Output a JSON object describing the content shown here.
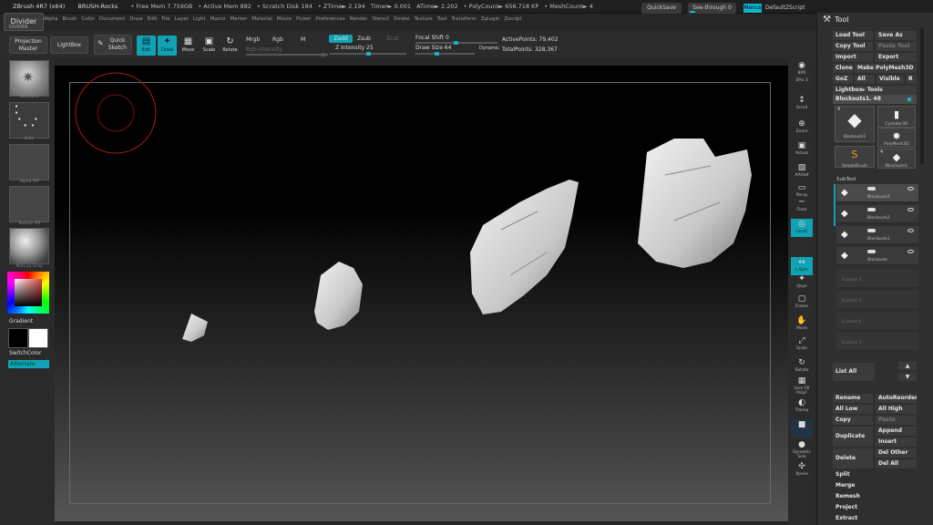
{
  "menubar": {
    "app_title": "ZBrush 4R7 (x64)",
    "document_name": "BRUSH-Rocks",
    "stats": [
      "• Free Mem 7.759GB",
      "• Active Mem 882",
      "• Scratch Disk 184",
      "• ZTime► 2.194",
      "Timer► 0.001",
      "ATime► 2.202",
      "• PolyCount► 656.718 KP",
      "• MeshCount► 4"
    ],
    "menus": [
      "Alpha",
      "Brush",
      "Color",
      "Document",
      "Draw",
      "Edit",
      "File",
      "Layer",
      "Light",
      "Macro",
      "Marker",
      "Material",
      "Movie",
      "Picker",
      "Preferences",
      "Render",
      "Stencil",
      "Stroke",
      "Texture",
      "Tool",
      "Transform",
      "Zplugin",
      "Zscript"
    ],
    "quicksave": "QuickSave",
    "see_through": "See-through  0",
    "menus_button": "Menus",
    "default_zscript": "DefaultZScript"
  },
  "tray_tab": {
    "label": "Divider",
    "sublabel": "DIVIDER"
  },
  "toolbar": {
    "projection_master": "Projection Master",
    "lightbox": "LightBox",
    "quick_sketch": "Quick Sketch",
    "edit": "Edit",
    "draw": "Draw",
    "move": "Move",
    "scale": "Scale",
    "rotate": "Rotate",
    "mrgb": "Mrgb",
    "rgb": "Rgb",
    "m": "M",
    "rgb_intensity": "Rgb Intensity",
    "zadd": "Zadd",
    "zsub": "Zsub",
    "zcut": "Zcut",
    "z_intensity": "Z Intensity 25",
    "z_intensity_value": 25,
    "focal_shift": "Focal Shift 0",
    "draw_size": "Draw Size 64",
    "dynamic": "Dynamic",
    "active_points": "ActivePoints: 79,402",
    "total_points": "TotalPoints: 328,367"
  },
  "left_shelf": {
    "brush_label": "Standard",
    "stroke_label": "Dots",
    "alpha_label": "Alpha Off",
    "texture_label": "Texture Off",
    "material_label": "MatCap Gray",
    "gradient": "Gradient",
    "switch_color": "SwitchColor",
    "alternate": "Alternate"
  },
  "right_dock": [
    {
      "name": "bpr",
      "label": "BPR",
      "icon": "◉"
    },
    {
      "name": "spix",
      "label": "SPix 3",
      "icon": ""
    },
    {
      "name": "scroll",
      "label": "Scroll",
      "icon": "↕"
    },
    {
      "name": "zoom",
      "label": "Zoom",
      "icon": "⊕"
    },
    {
      "name": "actual",
      "label": "Actual",
      "icon": "▣"
    },
    {
      "name": "aahalf",
      "label": "AAHalf",
      "icon": "▧"
    },
    {
      "name": "persp",
      "label": "Persp",
      "icon": "▭"
    },
    {
      "name": "floor",
      "label": "Floor",
      "icon": "─"
    },
    {
      "name": "local",
      "label": "Local",
      "icon": "◎"
    },
    {
      "name": "lsym",
      "label": "L.Sym",
      "icon": "↔"
    },
    {
      "name": "xyz",
      "label": "Qxyz",
      "icon": "✦"
    },
    {
      "name": "frame",
      "label": "Frame",
      "icon": "▢"
    },
    {
      "name": "move",
      "label": "Move",
      "icon": "✋"
    },
    {
      "name": "scale",
      "label": "Scale",
      "icon": "⤢"
    },
    {
      "name": "rotate",
      "label": "Rotate",
      "icon": "↻"
    },
    {
      "name": "linefill",
      "label": "Line Fill PolyF",
      "icon": "▦"
    },
    {
      "name": "transp",
      "label": "Transp",
      "icon": "◐"
    },
    {
      "name": "ghost",
      "label": "",
      "icon": "■"
    },
    {
      "name": "dynamic",
      "label": "Dynamic Solo",
      "icon": "●"
    },
    {
      "name": "xpose",
      "label": "Xpose",
      "icon": "✣"
    }
  ],
  "tool_panel": {
    "title": "Tool",
    "load_tool": "Load Tool",
    "save_as": "Save As",
    "copy_tool": "Copy Tool",
    "paste_tool": "Paste Tool",
    "import": "Import",
    "export": "Export",
    "clone": "Clone",
    "make_polymesh": "Make PolyMesh3D",
    "goz": "GoZ",
    "all": "All",
    "visible": "Visible",
    "r": "R",
    "lightbox_tools": "Lightbox▸ Tools",
    "current_tool": "Blockouts1. 48",
    "tools": [
      {
        "label": "Blockouts1",
        "count": "4",
        "icon": "rock"
      },
      {
        "label": "Cylinder3D",
        "count": "",
        "icon": "cylinder"
      },
      {
        "label": "SimpleBrush",
        "count": "",
        "icon": "s-brush"
      },
      {
        "label": "PolyMesh3D",
        "count": "",
        "icon": "star"
      },
      {
        "label": "Blockouts1",
        "count": "4",
        "icon": "rock-small"
      }
    ],
    "subtool_header": "SubTool",
    "subtools": [
      {
        "label": "Blockouts3"
      },
      {
        "label": "Blockouts2"
      },
      {
        "label": "Blockouts1"
      },
      {
        "label": "Blockouts"
      }
    ],
    "empty_slots": [
      "Subtool 4",
      "Subtool 5",
      "Subtool 6",
      "Subtool 7"
    ],
    "list_all": "List All",
    "rename": "Rename",
    "auto_reorder": "AutoReorder",
    "all_low": "All Low",
    "all_high": "All High",
    "copy": "Copy",
    "paste": "Paste",
    "duplicate": "Duplicate",
    "append": "Append",
    "insert": "Insert",
    "delete": "Delete",
    "del_other": "Del Other",
    "del_all": "Del All",
    "split": "Split",
    "merge": "Merge",
    "remesh": "Remesh",
    "project": "Project",
    "extract": "Extract"
  },
  "colors": {
    "accent": "#11a3b5",
    "background": "#262626",
    "panel": "#2f2f2f",
    "cursor_ring": "#c02020"
  }
}
